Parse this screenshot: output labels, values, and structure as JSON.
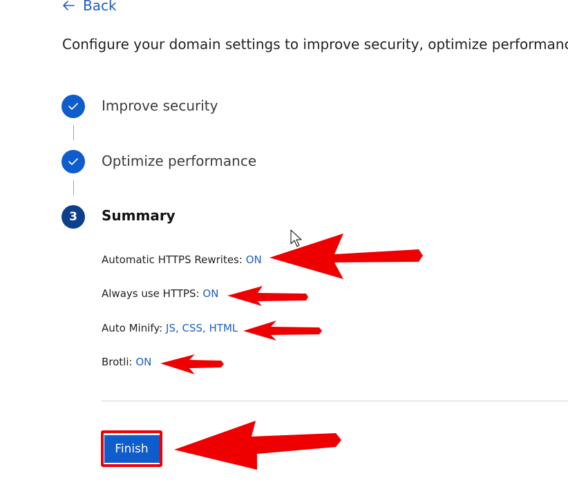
{
  "back": {
    "label": "Back",
    "icon": "arrow-left-icon"
  },
  "intro": "Configure your domain settings to improve security, optimize performance,",
  "steps": [
    {
      "label": "Improve security",
      "status": "completed",
      "icon": "check-icon"
    },
    {
      "label": "Optimize performance",
      "status": "completed",
      "icon": "check-icon"
    },
    {
      "label": "Summary",
      "status": "current",
      "number": "3"
    }
  ],
  "summary": [
    {
      "label": "Automatic HTTPS Rewrites: ",
      "value": "ON"
    },
    {
      "label": "Always use HTTPS: ",
      "value": "ON"
    },
    {
      "label": "Auto Minify: ",
      "value": "JS, CSS, HTML"
    },
    {
      "label": "Brotli: ",
      "value": "ON"
    }
  ],
  "finish_label": "Finish",
  "colors": {
    "accent": "#0f5ccc",
    "current_step": "#0c3f8c",
    "link": "#1b5fc1",
    "annotation_red": "#ef0000"
  }
}
